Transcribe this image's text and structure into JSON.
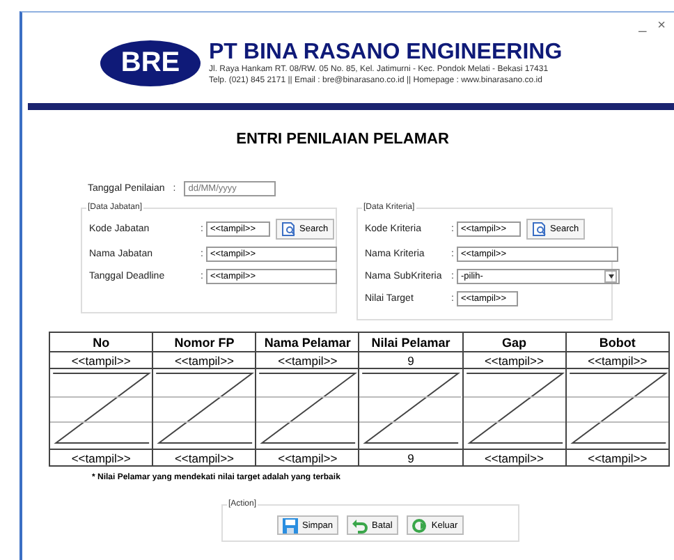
{
  "window": {
    "controls": [
      "_",
      "×"
    ]
  },
  "header": {
    "logo": "BRE",
    "company": "PT BINA RASANO ENGINEERING",
    "address": "Jl. Raya Hankam RT. 08/RW. 05 No. 85, Kel. Jatimurni - Kec. Pondok Melati - Bekasi 17431",
    "contact": "Telp. (021) 845 2171  || Email : bre@binarasano.co.id || Homepage : www.binarasano.co.id"
  },
  "form_title": "ENTRI PENILAIAN PELAMAR",
  "date_field": {
    "label": "Tanggal Penilaian",
    "colon": ":",
    "placeholder": "dd/MM/yyyy"
  },
  "groups": [
    {
      "title": "[Data Jabatan]",
      "fields": [
        {
          "kind": "search",
          "label": "Kode Jabatan",
          "colon": ":",
          "value": "<<tampil>>",
          "button": "Search"
        },
        {
          "kind": "text",
          "label": "Nama Jabatan",
          "colon": ":",
          "value": "<<tampil>>"
        },
        {
          "kind": "text",
          "label": "Tanggal Deadline",
          "colon": ":",
          "value": "<<tampil>>"
        }
      ]
    },
    {
      "title": "[Data Kriteria]",
      "fields": [
        {
          "kind": "search",
          "label": "Kode Kriteria",
          "colon": ":",
          "value": "<<tampil>>",
          "button": "Search"
        },
        {
          "kind": "text",
          "label": "Nama Kriteria",
          "colon": ":",
          "value": "<<tampil>>"
        },
        {
          "kind": "select",
          "label": "Nama SubKriteria",
          "colon": ":",
          "value": "-pilih-"
        },
        {
          "kind": "short",
          "label": "Nilai Target",
          "colon": ":",
          "value": "<<tampil>>"
        }
      ]
    }
  ],
  "table": {
    "columns": [
      "No",
      "Nomor FP",
      "Nama Pelamar",
      "Nilai Pelamar",
      "Gap",
      "Bobot"
    ],
    "rows": [
      {
        "kind": "data",
        "cells": [
          "<<tampil>>",
          "<<tampil>>",
          "<<tampil>>",
          "9",
          "<<tampil>>",
          "<<tampil>>"
        ]
      },
      {
        "kind": "repeat"
      },
      {
        "kind": "data",
        "cells": [
          "<<tampil>>",
          "<<tampil>>",
          "<<tampil>>",
          "9",
          "<<tampil>>",
          "<<tampil>>"
        ]
      }
    ]
  },
  "note": "* Nilai Pelamar yang mendekati nilai target adalah yang terbaik",
  "actions": {
    "title": "[Action]",
    "buttons": [
      {
        "kind": "save",
        "label": "Simpan"
      },
      {
        "kind": "undo",
        "label": "Batal"
      },
      {
        "kind": "exit",
        "label": "Keluar"
      }
    ]
  }
}
